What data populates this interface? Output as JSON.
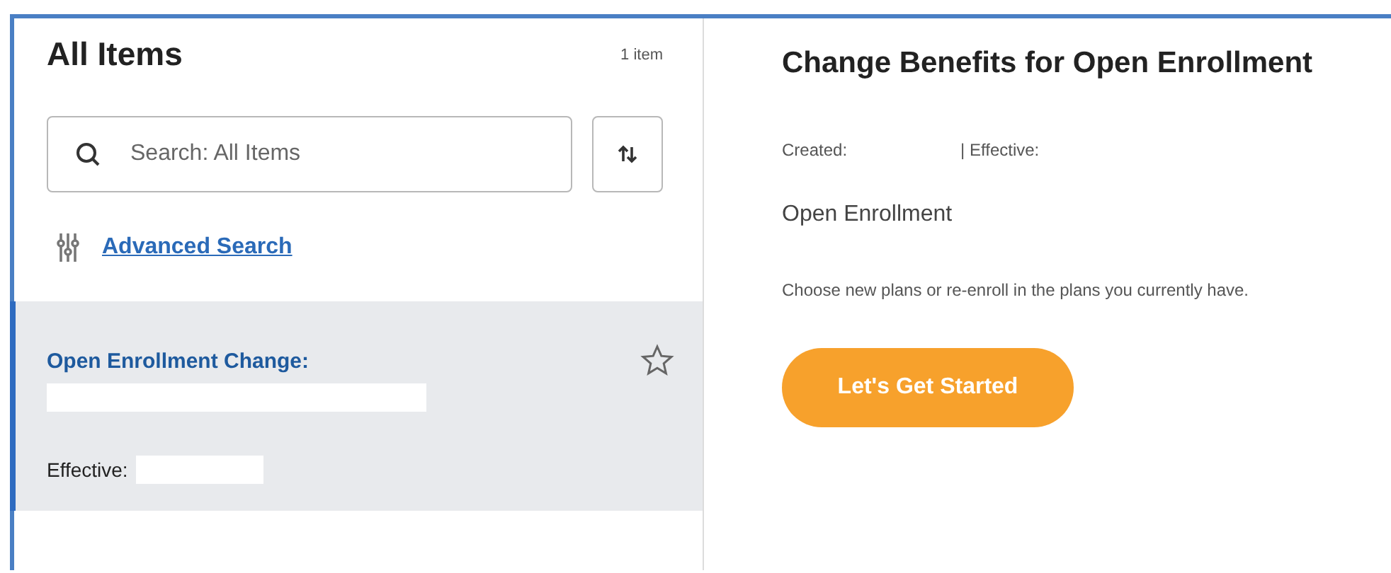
{
  "list_pane": {
    "title": "All Items",
    "count": "1 item",
    "search": {
      "placeholder": "Search: All Items"
    },
    "advanced_search": "Advanced Search",
    "items": [
      {
        "title": "Open Enrollment Change:",
        "effective_label": "Effective:",
        "selected": true,
        "starred": false
      }
    ]
  },
  "detail": {
    "title": "Change Benefits for Open Enrollment",
    "created_label": "Created:",
    "effective_label": "| Effective:",
    "subtitle": "Open Enrollment",
    "description": "Choose new plans or re-enroll in the plans you currently have.",
    "button": "Let's Get Started"
  }
}
